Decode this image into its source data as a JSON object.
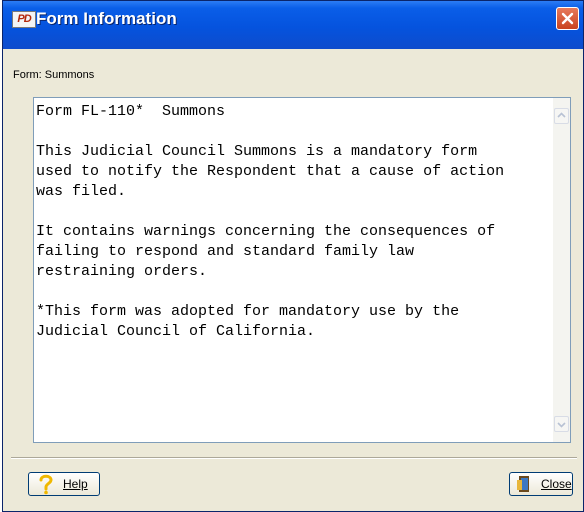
{
  "window": {
    "title": "Form Information",
    "app_icon_text": "PD",
    "close_icon": "close-icon"
  },
  "form": {
    "label": "Form: Summons",
    "content": "Form FL-110*  Summons\n\nThis Judicial Council Summons is a mandatory form\nused to notify the Respondent that a cause of action\nwas filed.\n\nIt contains warnings concerning the consequences of\nfailing to respond and standard family law\nrestraining orders.\n\n*This form was adopted for mandatory use by the\nJudicial Council of California."
  },
  "buttons": {
    "help": {
      "label": "Help",
      "icon": "question-mark-icon"
    },
    "close": {
      "label": "Close",
      "icon": "door-exit-icon"
    }
  },
  "colors": {
    "title_bar": "#0553de",
    "dialog_bg": "#ece9d8",
    "close_button": "#c9431f"
  }
}
